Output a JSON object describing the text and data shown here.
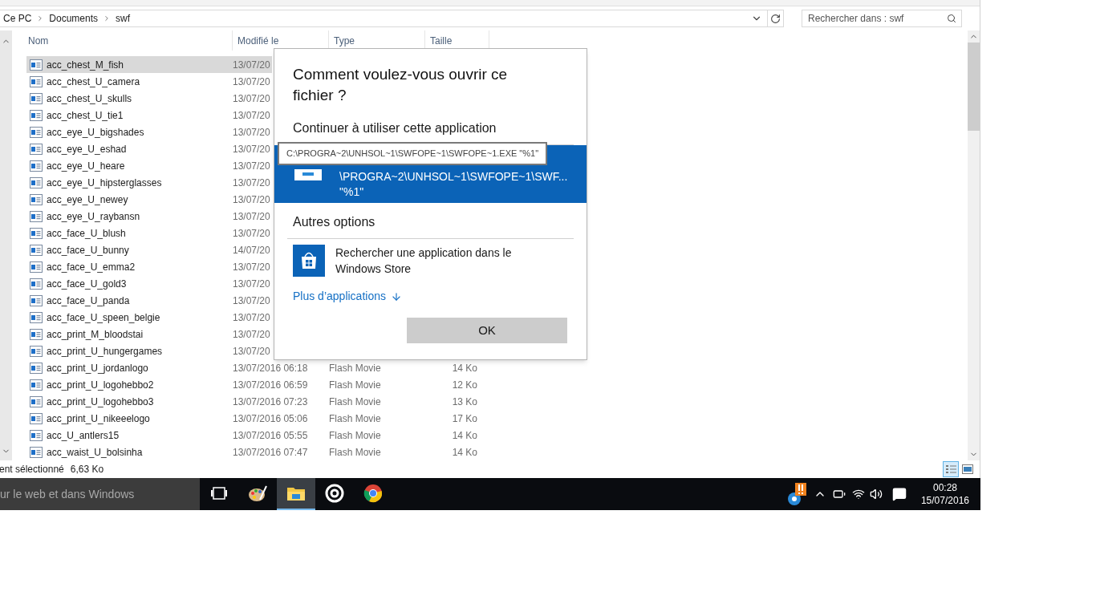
{
  "address_bar": {
    "breadcrumbs": [
      "Ce PC",
      "Documents",
      "swf"
    ]
  },
  "search": {
    "placeholder": "Rechercher dans : swf"
  },
  "table": {
    "columns": [
      "Nom",
      "Modifié le",
      "Type",
      "Taille"
    ],
    "rows": [
      {
        "name": "acc_chest_M_fish",
        "modified": "13/07/20",
        "selected": true
      },
      {
        "name": "acc_chest_U_camera",
        "modified": "13/07/20",
        "selected": false
      },
      {
        "name": "acc_chest_U_skulls",
        "modified": "13/07/20",
        "selected": false
      },
      {
        "name": "acc_chest_U_tie1",
        "modified": "13/07/20",
        "selected": false
      },
      {
        "name": "acc_eye_U_bigshades",
        "modified": "13/07/20",
        "selected": false
      },
      {
        "name": "acc_eye_U_eshad",
        "modified": "13/07/20",
        "selected": false
      },
      {
        "name": "acc_eye_U_heare",
        "modified": "13/07/20",
        "selected": false
      },
      {
        "name": "acc_eye_U_hipsterglasses",
        "modified": "13/07/20",
        "selected": false
      },
      {
        "name": "acc_eye_U_newey",
        "modified": "13/07/20",
        "selected": false
      },
      {
        "name": "acc_eye_U_raybansn",
        "modified": "13/07/20",
        "selected": false
      },
      {
        "name": "acc_face_U_blush",
        "modified": "13/07/20",
        "selected": false
      },
      {
        "name": "acc_face_U_bunny",
        "modified": "14/07/20",
        "selected": false
      },
      {
        "name": "acc_face_U_emma2",
        "modified": "13/07/20",
        "selected": false
      },
      {
        "name": "acc_face_U_gold3",
        "modified": "13/07/20",
        "selected": false
      },
      {
        "name": "acc_face_U_panda",
        "modified": "13/07/20",
        "selected": false
      },
      {
        "name": "acc_face_U_speen_belgie",
        "modified": "13/07/20",
        "selected": false
      },
      {
        "name": "acc_print_M_bloodstai",
        "modified": "13/07/20",
        "selected": false
      },
      {
        "name": "acc_print_U_hungergames",
        "modified": "13/07/20",
        "selected": false
      },
      {
        "name": "acc_print_U_jordanlogo",
        "modified": "13/07/2016 06:18",
        "type": "Flash Movie",
        "size": "14 Ko",
        "selected": false
      },
      {
        "name": "acc_print_U_logohebbo2",
        "modified": "13/07/2016 06:59",
        "type": "Flash Movie",
        "size": "12 Ko",
        "selected": false
      },
      {
        "name": "acc_print_U_logohebbo3",
        "modified": "13/07/2016 07:23",
        "type": "Flash Movie",
        "size": "13 Ko",
        "selected": false
      },
      {
        "name": "acc_print_U_nikeeelogo",
        "modified": "13/07/2016 05:06",
        "type": "Flash Movie",
        "size": "17 Ko",
        "selected": false
      },
      {
        "name": "acc_U_antlers15",
        "modified": "13/07/2016 05:55",
        "type": "Flash Movie",
        "size": "14 Ko",
        "selected": false
      },
      {
        "name": "acc_waist_U_bolsinha",
        "modified": "13/07/2016 07:47",
        "type": "Flash Movie",
        "size": "14 Ko",
        "selected": false
      }
    ]
  },
  "status_bar": {
    "selection": "ent sélectionné",
    "size": "6,63 Ko"
  },
  "dialog": {
    "title": "Comment voulez-vous ouvrir ce fichier ?",
    "current_section": "Continuer à utiliser cette application",
    "current_app": {
      "lines": [
        "\\PROGRA~2\\UNHSOL~1\\SWFOPE~1\\SWF...",
        "\"%1\""
      ],
      "selected": true
    },
    "tooltip": "C:\\PROGRA~2\\UNHSOL~1\\SWFOPE~1\\SWFOPE~1.EXE \"%1\"",
    "other_section": "Autres options",
    "store_option": "Rechercher une application dans le Windows Store",
    "more_link": "Plus d’applications",
    "ok_button": "OK"
  },
  "taskbar": {
    "search_text": "ur le web et dans Windows",
    "apps": [
      {
        "kind": "taskview",
        "selected": false
      },
      {
        "kind": "paint",
        "selected": false
      },
      {
        "kind": "explorer",
        "selected": true
      },
      {
        "kind": "groove",
        "selected": false
      },
      {
        "kind": "chrome",
        "selected": false
      }
    ],
    "time": "00:28",
    "date": "15/07/2016"
  }
}
